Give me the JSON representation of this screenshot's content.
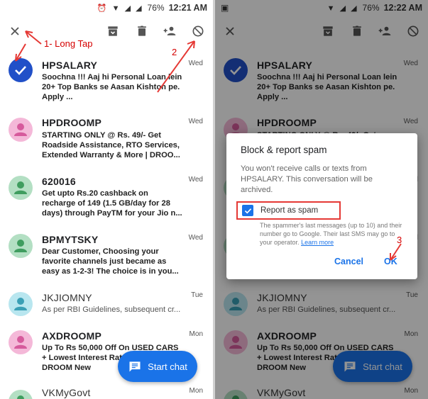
{
  "left": {
    "status": {
      "time": "12:21 AM",
      "battery": "76%"
    },
    "fab_label": "Start chat",
    "annotations": {
      "step1": "1- Long Tap",
      "step2": "2"
    }
  },
  "right": {
    "status": {
      "time": "12:22 AM",
      "battery": "76%"
    },
    "fab_label": "Start chat",
    "dialog": {
      "title": "Block & report spam",
      "body": "You won't receive calls or texts from HPSALARY. This conversation will be archived.",
      "checkbox_label": "Report as spam",
      "note": "The spammer's last messages (up to 10) and their number go to Google. Their last SMS may go to your operator.",
      "learn_more": "Learn more",
      "cancel": "Cancel",
      "ok": "OK"
    },
    "annotations": {
      "step3": "3"
    }
  },
  "conversations": [
    {
      "sender": "HPSALARY",
      "day": "Wed",
      "snippet": "Soochna !!! Aaj hi Personal Loan lein 20+ Top Banks se Aasan Kishton pe. Apply ...",
      "color": "#2150c8",
      "selected": true,
      "unread": true
    },
    {
      "sender": "HPDROOMP",
      "day": "Wed",
      "snippet": "STARTING ONLY @ Rs. 49/- Get Roadside Assistance, RTO Services, Extended Warranty & More | DROO...",
      "color": "#f4b8d8",
      "unread": true
    },
    {
      "sender": "620016",
      "day": "Wed",
      "snippet": "Get upto Rs.20 cashback on recharge of 149 (1.5 GB/day for 28 days) through PayTM for your Jio n...",
      "color": "#b3dfc3",
      "unread": true
    },
    {
      "sender": "BPMYTSKY",
      "day": "Wed",
      "snippet": "Dear Customer, Choosing your favorite channels just became as easy as 1-2-3! The choice is in you...",
      "color": "#b3dfc3",
      "unread": true
    },
    {
      "sender": "JKJIOMNY",
      "day": "Tue",
      "snippet": "As per RBI Guidelines, subsequent cr...",
      "color": "#b8e6ef",
      "unread": false
    },
    {
      "sender": "AXDROOMP",
      "day": "Mon",
      "snippet": "Up To Rs 50,000 Off On USED CARS + Lowest Interest Rate Only On DROOM New",
      "color": "#f4b8d8",
      "unread": true
    },
    {
      "sender": "VKMyGovt",
      "day": "Mon",
      "snippet": "",
      "color": "#b3dfc3",
      "unread": false
    }
  ],
  "icons": {
    "close": "close-icon",
    "archive": "archive-icon",
    "delete": "delete-icon",
    "add_contact": "add-contact-icon",
    "block": "block-icon",
    "chat": "chat-icon",
    "check": "check-icon",
    "person": "person-icon"
  },
  "colors": {
    "accent": "#1a73e8",
    "annotation": "#e53935"
  }
}
